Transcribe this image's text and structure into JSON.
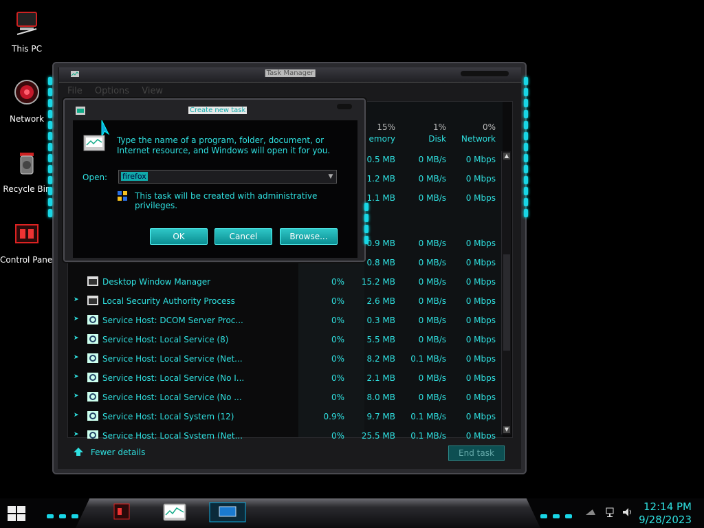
{
  "desktop": {
    "icons": [
      {
        "label": "This PC"
      },
      {
        "label": "Network"
      },
      {
        "label": "Recycle Bin"
      },
      {
        "label": "Control Panel"
      }
    ]
  },
  "task_manager": {
    "title": "Task Manager",
    "menu": [
      "File",
      "Options",
      "View"
    ],
    "columns": {
      "memory": {
        "pct": "15%",
        "name": "emory"
      },
      "disk": {
        "pct": "1%",
        "name": "Disk"
      },
      "network": {
        "pct": "0%",
        "name": "Network"
      }
    },
    "partial_rows": [
      {
        "mem": "0.5 MB",
        "disk": "0 MB/s",
        "net": "0 Mbps"
      },
      {
        "mem": "1.2 MB",
        "disk": "0 MB/s",
        "net": "0 Mbps"
      },
      {
        "mem": "1.1 MB",
        "disk": "0 MB/s",
        "net": "0 Mbps"
      },
      {
        "mem": "0.9 MB",
        "disk": "0 MB/s",
        "net": "0 Mbps"
      },
      {
        "mem": "0.8 MB",
        "disk": "0 MB/s",
        "net": "0 Mbps"
      }
    ],
    "rows": [
      {
        "name": "Desktop Window Manager",
        "cpu": "0%",
        "mem": "15.2 MB",
        "disk": "0 MB/s",
        "net": "0 Mbps",
        "expandable": false,
        "icon": "window-icon"
      },
      {
        "name": "Local Security Authority Process",
        "cpu": "0%",
        "mem": "2.6 MB",
        "disk": "0 MB/s",
        "net": "0 Mbps",
        "expandable": true,
        "icon": "window-icon"
      },
      {
        "name": "Service Host: DCOM Server Proc...",
        "cpu": "0%",
        "mem": "0.3 MB",
        "disk": "0 MB/s",
        "net": "0 Mbps",
        "expandable": true,
        "icon": "gear-icon"
      },
      {
        "name": "Service Host: Local Service (8)",
        "cpu": "0%",
        "mem": "5.5 MB",
        "disk": "0 MB/s",
        "net": "0 Mbps",
        "expandable": true,
        "icon": "gear-icon"
      },
      {
        "name": "Service Host: Local Service (Net...",
        "cpu": "0%",
        "mem": "8.2 MB",
        "disk": "0.1 MB/s",
        "net": "0 Mbps",
        "expandable": true,
        "icon": "gear-icon"
      },
      {
        "name": "Service Host: Local Service (No I...",
        "cpu": "0%",
        "mem": "2.1 MB",
        "disk": "0 MB/s",
        "net": "0 Mbps",
        "expandable": true,
        "icon": "gear-icon"
      },
      {
        "name": "Service Host: Local Service (No ...",
        "cpu": "0%",
        "mem": "8.0 MB",
        "disk": "0 MB/s",
        "net": "0 Mbps",
        "expandable": true,
        "icon": "gear-icon"
      },
      {
        "name": "Service Host: Local System (12)",
        "cpu": "0.9%",
        "mem": "9.7 MB",
        "disk": "0.1 MB/s",
        "net": "0 Mbps",
        "expandable": true,
        "icon": "gear-icon"
      },
      {
        "name": "Service Host: Local System (Net...",
        "cpu": "0%",
        "mem": "25.5 MB",
        "disk": "0.1 MB/s",
        "net": "0 Mbps",
        "expandable": true,
        "icon": "gear-icon"
      }
    ],
    "fewer_details": "Fewer details",
    "end_task": "End task"
  },
  "dialog": {
    "title": "Create new task",
    "message": "Type the name of a program, folder, document, or Internet resource, and Windows will open it for you.",
    "open_label": "Open:",
    "open_value": "firefox",
    "admin_note": "This task will be created with administrative privileges.",
    "ok": "OK",
    "cancel": "Cancel",
    "browse": "Browse..."
  },
  "taskbar": {
    "time": "12:14 PM",
    "date": "9/28/2023"
  },
  "colors": {
    "accent": "#2fe0e0",
    "button": "#1aa6aa",
    "background": "#000000"
  }
}
